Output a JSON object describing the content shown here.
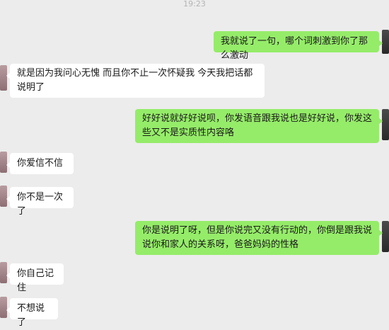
{
  "status_bar": {
    "time": "19:23"
  },
  "messages": [
    {
      "side": "out",
      "text": "我就说了一句，哪个词刺激到你了那么激动"
    },
    {
      "side": "in",
      "text": "就是因为我问心无愧 而且你不止一次怀疑我 今天我把话都说明了"
    },
    {
      "side": "out",
      "text": "好好说就好好说呗，你发语音跟我说也是好好说，你发这些又不是实质性内容咯"
    },
    {
      "side": "in",
      "text": "你爱信不信"
    },
    {
      "side": "in",
      "text": "你不是一次了"
    },
    {
      "side": "out",
      "text": "你是说明了呀，但是你说完又没有行动的，你倒是跟我说说你和家人的关系呀，爸爸妈妈的性格"
    },
    {
      "side": "in",
      "text": "你自己记住"
    },
    {
      "side": "in",
      "text": "不想说了"
    }
  ],
  "colors": {
    "background": "#ececec",
    "outgoing_bubble": "#95ec69",
    "incoming_bubble": "#ffffff"
  }
}
